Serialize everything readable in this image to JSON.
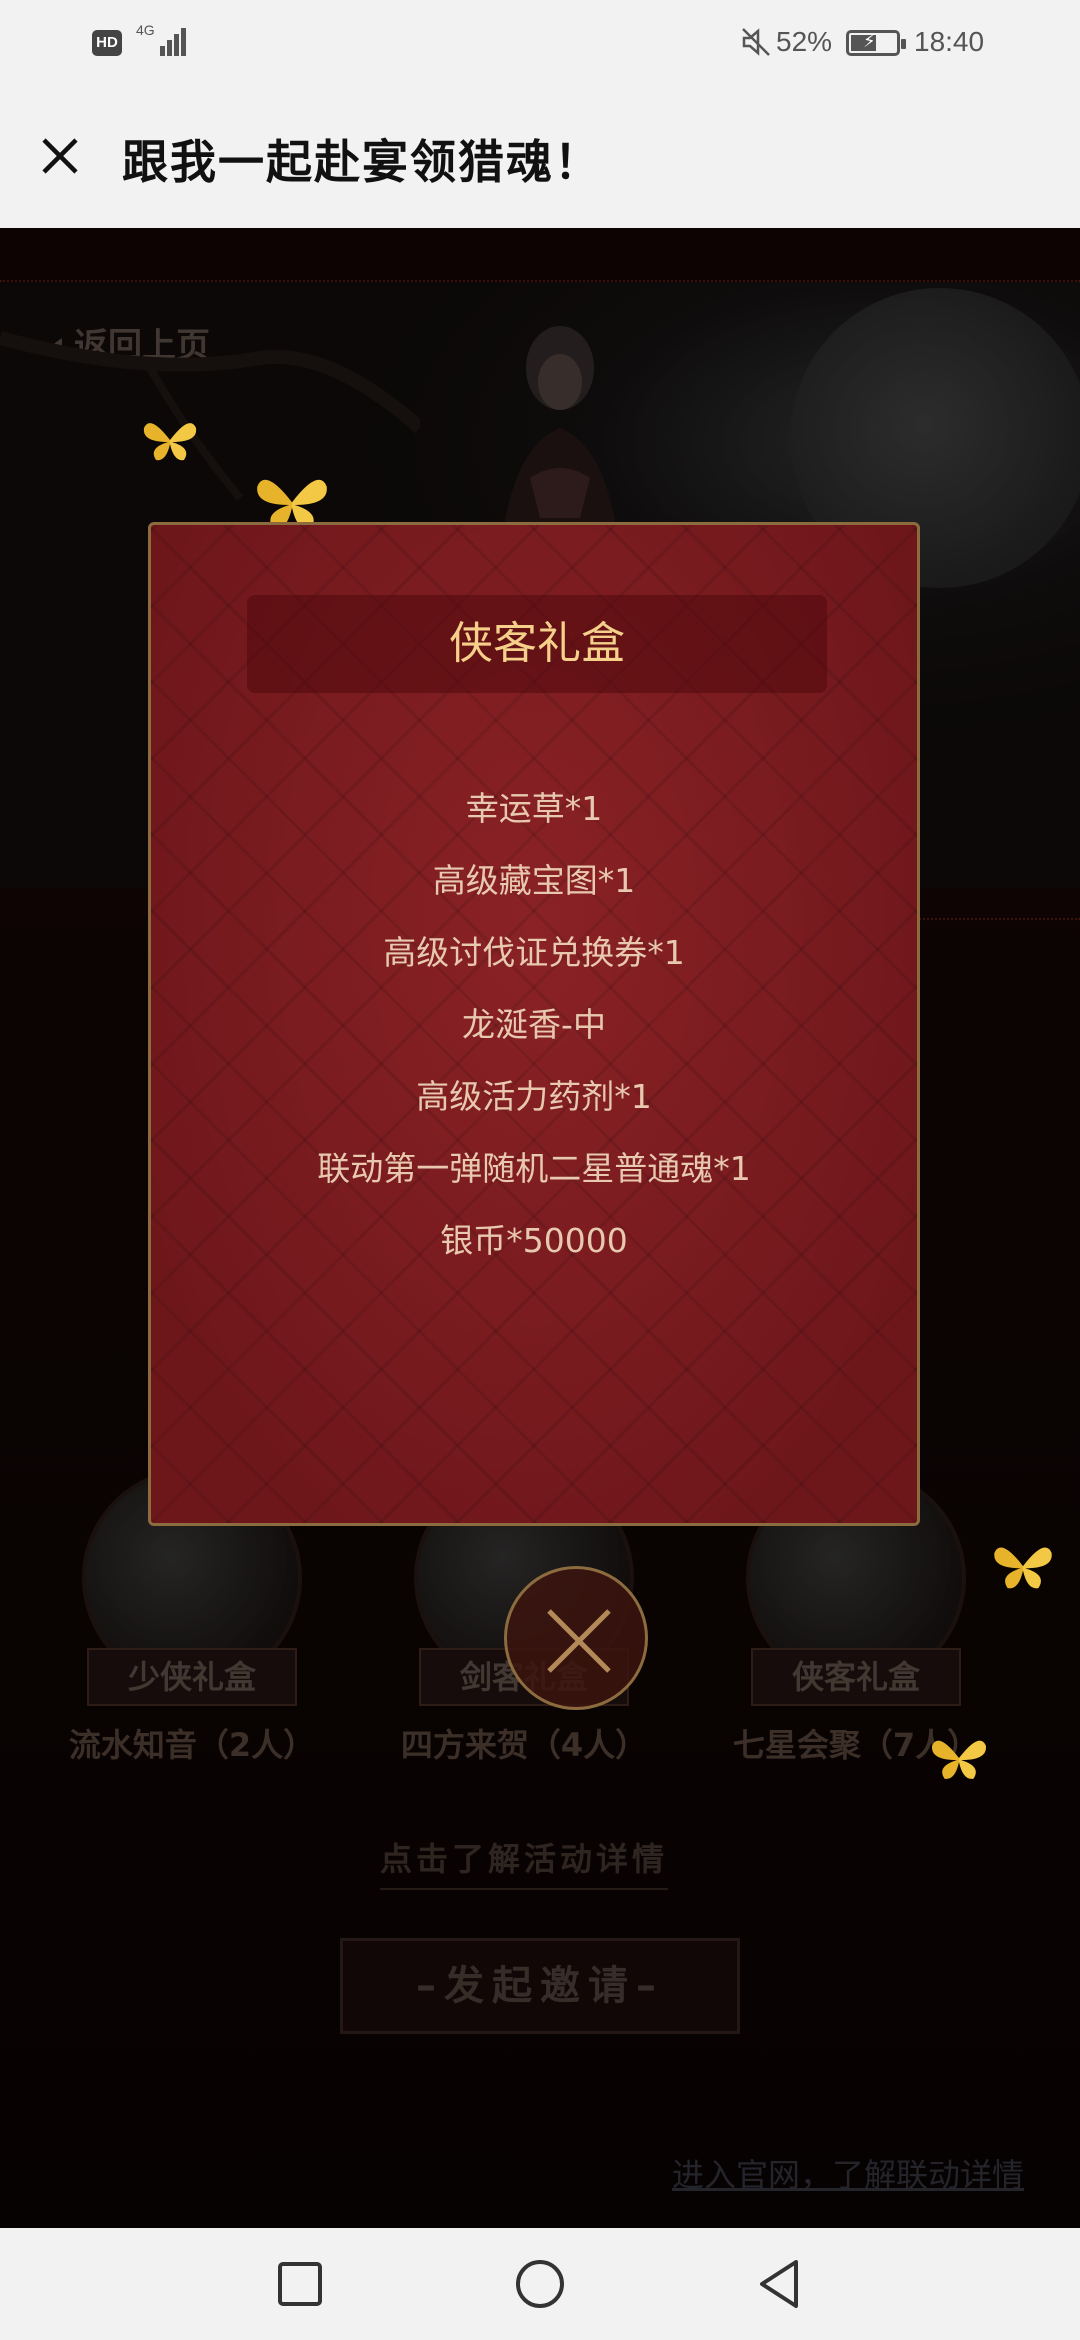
{
  "status_bar": {
    "hd": "HD",
    "network": "4G",
    "battery_percent": "52%",
    "battery_level": 0.52,
    "time": "18:40"
  },
  "title_bar": {
    "title": "跟我一起赴宴领猎魂！"
  },
  "game": {
    "back_label": "返回上页",
    "gifts": [
      {
        "badge": "少侠礼盒",
        "subtitle": "流水知音（2人）"
      },
      {
        "badge": "剑客礼盒",
        "subtitle": "四方来贺（4人）"
      },
      {
        "badge": "侠客礼盒",
        "subtitle": "七星会聚（7人）"
      }
    ],
    "detail_link": "点击了解活动详情",
    "invite_button": "–发起邀请–",
    "official_link": "进入官网，了解联动详情"
  },
  "modal": {
    "title": "侠客礼盒",
    "items": [
      "幸运草*1",
      "高级藏宝图*1",
      "高级讨伐证兑换券*1",
      "龙涎香-中",
      "高级活力药剂*1",
      "联动第一弹随机二星普通魂*1",
      "银币*50000"
    ]
  },
  "colors": {
    "modal_bg": "#7a1b1e",
    "modal_border": "#8c6b3e",
    "title_gold": "#f5d08a",
    "butterfly": "#f6c22e"
  },
  "icons": {
    "close": "close-icon",
    "home": "circle-home-icon",
    "recents": "square-recents-icon",
    "back": "triangle-back-icon"
  }
}
